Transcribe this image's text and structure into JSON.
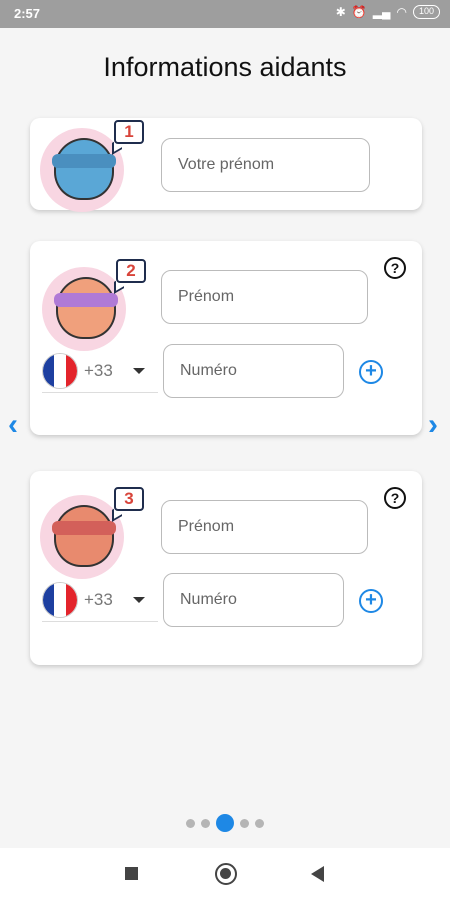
{
  "status": {
    "time": "2:57",
    "battery": "100"
  },
  "page": {
    "title": "Informations aidants"
  },
  "cards": [
    {
      "badge": "1",
      "first_name_placeholder": "Votre prénom",
      "avatar_color": "#5aa7d6",
      "mask_color": "#4a8fbf"
    },
    {
      "badge": "2",
      "first_name_placeholder": "Prénom",
      "country_code": "+33",
      "number_placeholder": "Numéro",
      "avatar_color": "#f0a07c",
      "mask_color": "#b07ad6",
      "help": "?",
      "add": "+"
    },
    {
      "badge": "3",
      "first_name_placeholder": "Prénom",
      "country_code": "+33",
      "number_placeholder": "Numéro",
      "avatar_color": "#e88a6e",
      "mask_color": "#d3605a",
      "help": "?",
      "add": "+"
    }
  ],
  "nav": {
    "prev": "‹",
    "next": "›"
  },
  "pager": {
    "count": 5,
    "active": 2
  },
  "colors": {
    "accent": "#1e88e5",
    "badge_text": "#d8443a"
  }
}
